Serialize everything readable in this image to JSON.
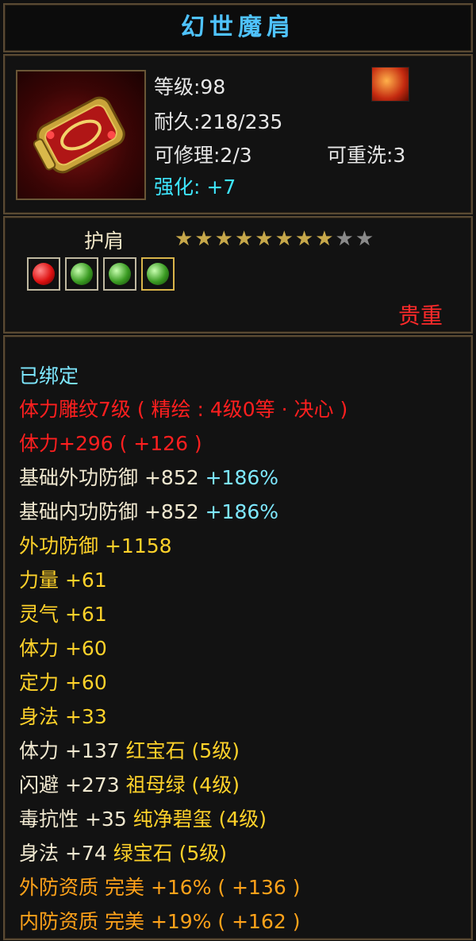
{
  "item": {
    "name": "幻世魔肩",
    "level": "等级:98",
    "durability": "耐久:218/235",
    "repair": "可修理:2/3",
    "rewash": "可重洗:3",
    "enhance_label": "强化:",
    "enhance_value": "+7",
    "subtype": "护肩",
    "stars_filled": 8,
    "stars_total": 10,
    "star_glyph": "★",
    "gems": [
      "ruby-gem-icon",
      "emerald-gem-icon",
      "emerald-gem-icon",
      "jade-gem-icon"
    ],
    "rarity": "贵重"
  },
  "props": {
    "bound": "已绑定",
    "carve": "体力雕纹7级 ( 精绘 : 4级0等 · 决心 )",
    "vit_main": "体力+296 ( +126 )",
    "base_ext_def_label": "基础外功防御",
    "base_ext_def_val": "+852",
    "base_ext_def_pct": "+186%",
    "base_int_def_label": "基础内功防御",
    "base_int_def_val": "+852",
    "base_int_def_pct": "+186%",
    "ext_def_label": "外功防御",
    "ext_def_val": "+1158",
    "str_label": "力量",
    "str_val": "+61",
    "spirit_label": "灵气",
    "spirit_val": "+61",
    "vit_label": "体力",
    "vit_val": "+60",
    "focus_label": "定力",
    "focus_val": "+60",
    "agi_label": "身法",
    "agi_val": "+33",
    "gem1_stat": "体力",
    "gem1_val": "+137",
    "gem1_name": "红宝石 (5级)",
    "gem2_stat": "闪避",
    "gem2_val": "+273",
    "gem2_name": "祖母绿 (4级)",
    "gem3_stat": "毒抗性",
    "gem3_val": "+35",
    "gem3_name": "纯净碧玺 (4级)",
    "gem4_stat": "身法",
    "gem4_val": "+74",
    "gem4_name": "绿宝石 (5级)",
    "apt1_label": "外防资质",
    "apt1_grade": "完美",
    "apt1_val": "+16%",
    "apt1_bonus": "( +136 )",
    "apt2_label": "内防资质",
    "apt2_grade": "完美",
    "apt2_val": "+19%",
    "apt2_bonus": "( +162 )"
  },
  "colors": {
    "title": "#4fc3ff",
    "enhance": "#3ee6ff",
    "carve": "#ff1f1f",
    "stat": "#ffd22a",
    "aptitude": "#ffa21a",
    "rarity": "#ff2a2a",
    "border": "#5a4a33"
  }
}
